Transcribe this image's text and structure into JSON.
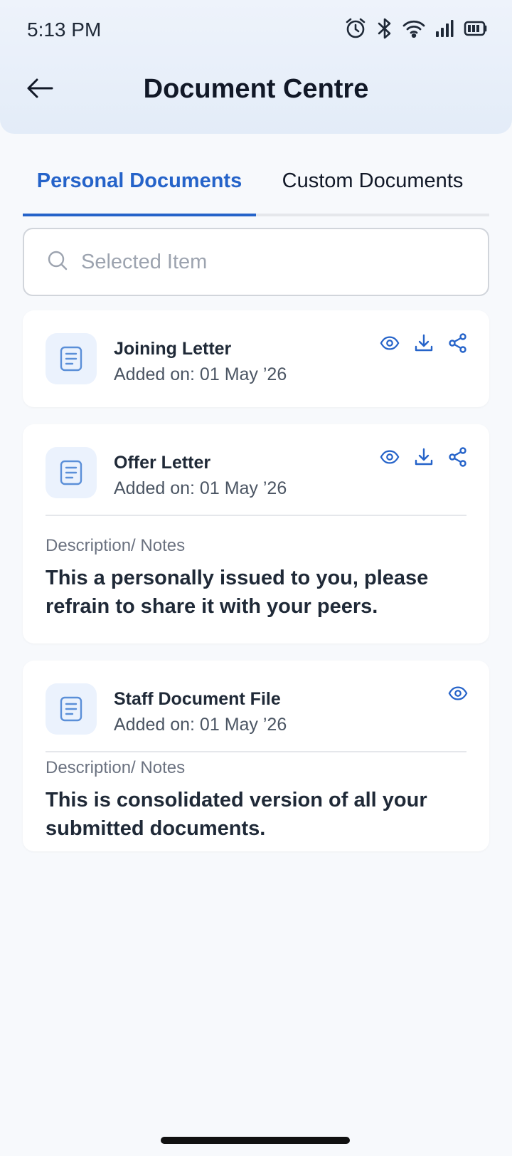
{
  "status_bar": {
    "time": "5:13 PM"
  },
  "header": {
    "title": "Document Centre"
  },
  "tabs": [
    {
      "label": "Personal Documents",
      "active": true
    },
    {
      "label": "Custom Documents",
      "active": false
    }
  ],
  "search": {
    "placeholder": "Selected Item",
    "value": ""
  },
  "documents": [
    {
      "title": "Joining Letter",
      "date": "Added on: 01 May ’26",
      "actions": [
        "eye-icon",
        "download-icon",
        "share-icon"
      ]
    },
    {
      "title": "Offer Letter",
      "date": "Added on: 01 May ’26",
      "actions": [
        "eye-icon",
        "download-icon",
        "share-icon"
      ],
      "notes_label": "Description/ Notes",
      "notes": "This a personally issued to you, please refrain to share it with your peers."
    },
    {
      "title": "Staff Document File",
      "date": "Added on: 01 May ’26",
      "actions": [
        "eye-icon"
      ],
      "notes_label": "Description/ Notes",
      "notes": "This is consolidated version of all your submitted documents."
    }
  ],
  "colors": {
    "accent": "#2563c9",
    "header_bg": "#e3ecf8",
    "icon_tile": "#ebf2fd",
    "page_bg": "#f7f9fc"
  }
}
